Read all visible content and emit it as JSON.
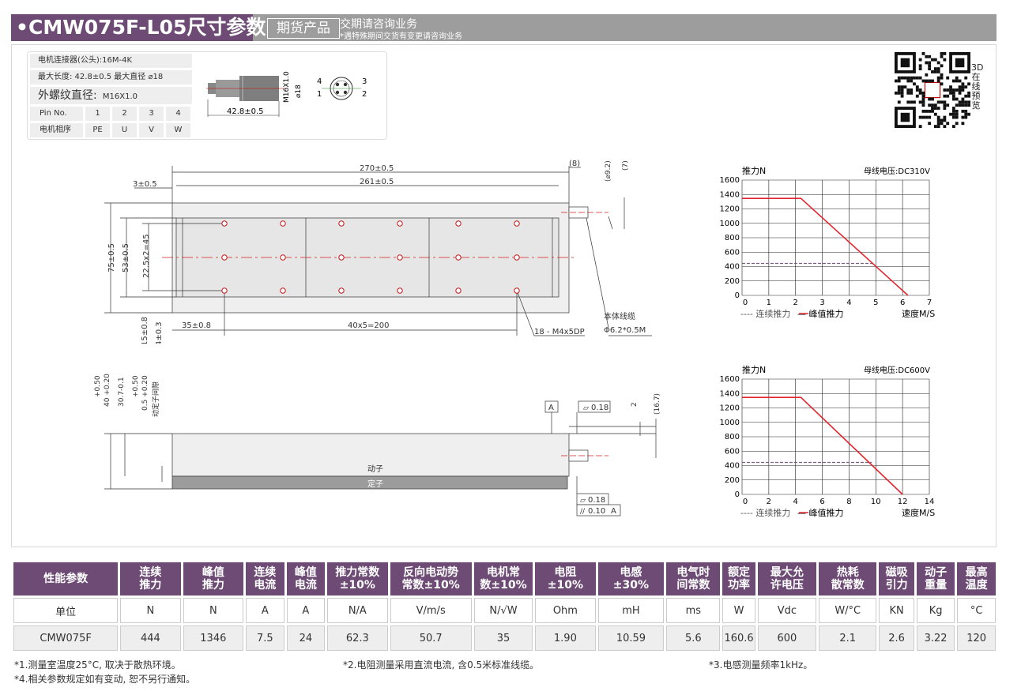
{
  "header": {
    "title": "•CMW075F-L05尺寸参数",
    "badge": "期货产品",
    "note": "交期请咨询业务",
    "subnote": "*遇特殊期间交货有变更请咨询业务"
  },
  "connector": {
    "type": "电机连接器(公头):16M-4K",
    "dims": "最大长度: 42.8±0.5   最大直径 ⌀18",
    "thread_label": "外螺纹直径:",
    "thread_value": "M16X1.0",
    "pin_row_label": "Pin No.",
    "pins": [
      "1",
      "2",
      "3",
      "4"
    ],
    "phase_row_label": "电机相序",
    "phases": [
      "PE",
      "U",
      "V",
      "W"
    ],
    "sketch_length": "42.8±0.5",
    "sketch_dia": "⌀18",
    "sketch_thread": "M16X1.0",
    "face_pins": [
      "4",
      "3",
      "1",
      "2"
    ]
  },
  "qr": {
    "caption": "3D在线预览"
  },
  "drawing_top": {
    "dim_270": "270±0.5",
    "dim_261": "261±0.5",
    "dim_8": "(8)",
    "dim_9_2": "(⌀9.2)",
    "dim_7": "(7)",
    "dim_3": "3±0.5",
    "dim_75": "75±0.5",
    "dim_53": "53±0.5",
    "dim_22": "22.5x2=45",
    "dim_15": "15±0.8",
    "dim_4": "4±0.3",
    "dim_35": "35±0.8",
    "dim_pitch": "40x5=200",
    "holes": "18 - M4x5DP",
    "cable_label": "本体线缆",
    "cable_spec": "Φ6.2*0.5M"
  },
  "drawing_side": {
    "dim_40": "40 +0.20",
    "dim_40_tol": "+0.50",
    "dim_30": "30.7-0.1",
    "dim_gap": "0.5 +0.20",
    "dim_gap_tol": "+0.50",
    "gap_label": "动定子间隙",
    "datum": "A",
    "flat_top": "0.18",
    "dim_2": "2",
    "dim_16": "(16.7)",
    "mover": "动子",
    "stator": "定子",
    "flat_bottom": "0.18",
    "par_value": "0.10",
    "par_datum": "A"
  },
  "charts": {
    "y_unit": "推力N",
    "x_unit": "速度M/S",
    "legend_cont": "---- 连续推力",
    "legend_peak": "— 峰值推力",
    "continuous_color": "#7b5a86",
    "peak_color": "#e0262e"
  },
  "chart_data": [
    {
      "type": "line",
      "title": "母线电压:DC310V",
      "ylabel": "推力N",
      "xlabel": "速度M/S",
      "xlim": [
        0,
        7
      ],
      "ylim": [
        0,
        1600
      ],
      "x_ticks": [
        0,
        1,
        2,
        3,
        4,
        5,
        6,
        7
      ],
      "y_ticks": [
        0,
        200,
        400,
        600,
        800,
        1000,
        1200,
        1400,
        1600
      ],
      "grid": true,
      "legend": "bottom",
      "series": [
        {
          "name": "连续推力",
          "style": "dashed",
          "x": [
            0,
            4.9
          ],
          "y": [
            444,
            444
          ]
        },
        {
          "name": "峰值推力",
          "style": "solid",
          "x": [
            0,
            2.2,
            6.2
          ],
          "y": [
            1346,
            1346,
            0
          ]
        }
      ]
    },
    {
      "type": "line",
      "title": "母线电压:DC600V",
      "ylabel": "推力N",
      "xlabel": "速度M/S",
      "xlim": [
        0,
        14
      ],
      "ylim": [
        0,
        1600
      ],
      "x_ticks": [
        0,
        2,
        4,
        6,
        8,
        10,
        12,
        14
      ],
      "y_ticks": [
        0,
        200,
        400,
        600,
        800,
        1000,
        1200,
        1400,
        1600
      ],
      "grid": true,
      "legend": "bottom",
      "series": [
        {
          "name": "连续推力",
          "style": "dashed",
          "x": [
            0,
            9.7
          ],
          "y": [
            444,
            444
          ]
        },
        {
          "name": "峰值推力",
          "style": "solid",
          "x": [
            0,
            4.4,
            12.0
          ],
          "y": [
            1346,
            1346,
            0
          ]
        }
      ]
    }
  ],
  "spec_table": {
    "headers": [
      "性能参数",
      "连续\n推力",
      "峰值\n推力",
      "连续\n电流",
      "峰值\n电流",
      "推力常数\n±10%",
      "反向电动势\n常数±10%",
      "电机常\n数±10%",
      "电阻\n±10%",
      "电感\n±30%",
      "电气时\n间常数",
      "额定\n功率",
      "最大允\n许电压",
      "热耗\n散常数",
      "磁吸\n引力",
      "动子\n重量",
      "最高\n温度"
    ],
    "units": [
      "单位",
      "N",
      "N",
      "A",
      "A",
      "N/A",
      "V/m/s",
      "N/√W",
      "Ohm",
      "mH",
      "ms",
      "W",
      "Vdc",
      "W/°C",
      "KN",
      "Kg",
      "°C"
    ],
    "values": [
      "CMW075F",
      "444",
      "1346",
      "7.5",
      "24",
      "62.3",
      "50.7",
      "35",
      "1.90",
      "10.59",
      "5.6",
      "160.6",
      "600",
      "2.1",
      "2.6",
      "3.22",
      "120"
    ]
  },
  "footnotes": {
    "n1": "*1.测量室温度25°C, 取决于散热环境。",
    "n2": "*2.电阻测量采用直流电流, 含0.5米标准线缆。",
    "n3": "*3.电感测量频率1kHz。",
    "n4": "*4.相关参数规定如有变动, 恕不另行通知。"
  }
}
